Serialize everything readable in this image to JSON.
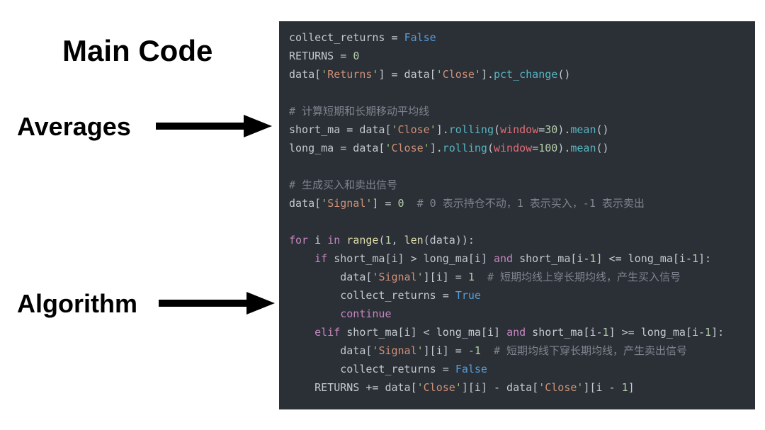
{
  "labels": {
    "title": "Main Code",
    "averages": "Averages",
    "algorithm": "Algorithm"
  },
  "code": {
    "line1_a": "collect_returns = ",
    "line1_false": "False",
    "line2_a": "RETURNS = ",
    "line2_zero": "0",
    "line3_a": "data[",
    "q": "'",
    "str_returns": "Returns",
    "line3_b": "] = data[",
    "str_close": "Close",
    "line3_c": "].",
    "fn_pct": "pct_change",
    "paren": "()",
    "blank": "",
    "cmt1": "# 计算短期和长期移动平均线",
    "line5_a": "short_ma = data[",
    "line5_b": "].",
    "fn_rolling": "rolling",
    "lp": "(",
    "arg_window": "window",
    "eq": "=",
    "num30": "30",
    "rp": ")",
    "dot": ".",
    "fn_mean": "mean",
    "line6_a": "long_ma = data[",
    "num100": "100",
    "cmt2": "# 生成买入和卖出信号",
    "line9_a": "data[",
    "str_signal": "Signal",
    "line9_b": "] = ",
    "num0": "0",
    "cmt_inline1": "  # 0 表示持仓不动，1 表示买入，-1 表示卖出",
    "kw_for": "for",
    "line11_a": " i ",
    "kw_in": "in",
    "sp": " ",
    "fn_range": "range",
    "num1": "1",
    "comma": ", ",
    "fn_len": "len",
    "line11_b": "(data)):",
    "ind1": "    ",
    "ind2": "        ",
    "kw_if": "if",
    "line12_a": " short_ma[i] > long_ma[i] ",
    "kw_and": "and",
    "line12_b": " short_ma[i-",
    "line12_c": "] <= long_ma[i-",
    "line12_d": "]:",
    "line13_a": "data[",
    "line13_b": "][i] = ",
    "cmt_inline2": "  # 短期均线上穿长期均线，产生买入信号",
    "line14_a": "collect_returns = ",
    "bool_true": "True",
    "kw_continue": "continue",
    "kw_elif": "elif",
    "line16_a": " short_ma[i] < long_ma[i] ",
    "line16_b": " short_ma[i-",
    "line16_c": "] >= long_ma[i-",
    "line16_d": "]:",
    "numm1": "-1",
    "cmt_inline3": "  # 短期均线下穿长期均线，产生卖出信号",
    "bool_false2": "False",
    "line19_a": "RETURNS += data[",
    "line19_b": "][i] - data[",
    "line19_c": "][i - ",
    "rb": "]"
  }
}
